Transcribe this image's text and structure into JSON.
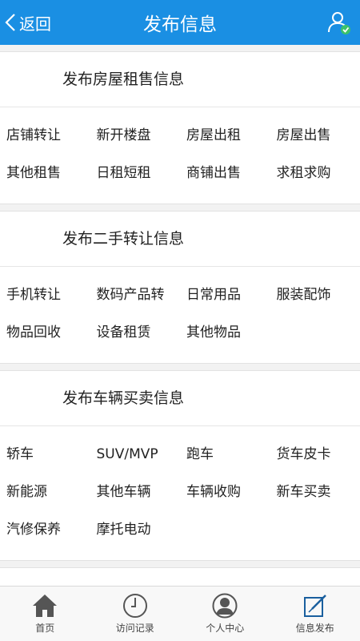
{
  "header": {
    "back_label": "返回",
    "title": "发布信息"
  },
  "sections": [
    {
      "title": "发布房屋租售信息",
      "items": [
        "店铺转让",
        "新开楼盘",
        "房屋出租",
        "房屋出售",
        "其他租售",
        "日租短租",
        "商铺出售",
        "求租求购"
      ]
    },
    {
      "title": "发布二手转让信息",
      "items": [
        "手机转让",
        "数码产品转",
        "日常用品",
        "服装配饰",
        "物品回收",
        "设备租赁",
        "其他物品"
      ]
    },
    {
      "title": "发布车辆买卖信息",
      "items": [
        "轿车",
        "SUV/MVP",
        "跑车",
        "货车皮卡",
        "新能源",
        "其他车辆",
        "车辆收购",
        "新车买卖",
        "汽修保养",
        "摩托电动"
      ]
    }
  ],
  "tabs": [
    {
      "label": "首页",
      "icon": "home-icon"
    },
    {
      "label": "访问记录",
      "icon": "clock-icon"
    },
    {
      "label": "个人中心",
      "icon": "person-icon"
    },
    {
      "label": "信息发布",
      "icon": "edit-icon"
    }
  ],
  "colors": {
    "header_bg": "#1a8fe3",
    "user_badge": "#3cc26a"
  }
}
